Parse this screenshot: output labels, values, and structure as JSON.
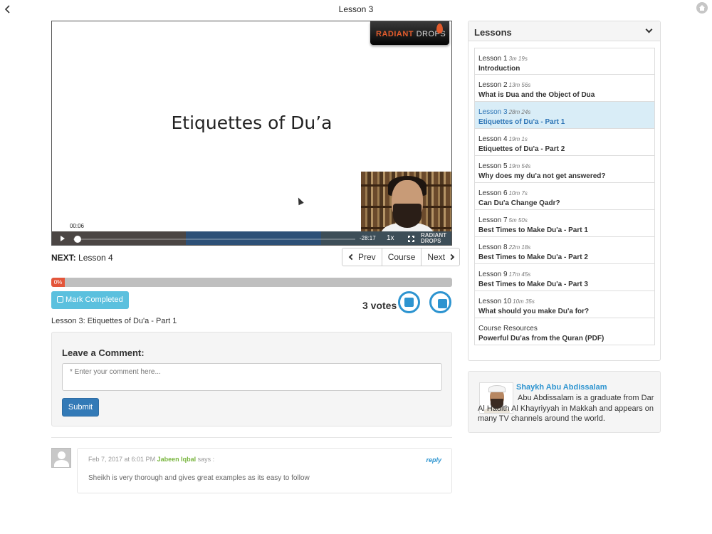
{
  "header": {
    "title": "Lesson 3"
  },
  "video": {
    "slide_title": "Etiquettes of Du’a",
    "brand_primary": "RADIANT",
    "brand_secondary": "DROPS",
    "current_time": "00:06",
    "remaining_time": "-28:17",
    "speed": "1x",
    "control_logo": "RADIANT DROPS"
  },
  "nav": {
    "next_label": "NEXT:",
    "next_value": "Lesson 4",
    "prev_button": "Prev",
    "course_button": "Course",
    "next_button": "Next"
  },
  "progress": {
    "percent_label": "0%",
    "value": 0
  },
  "actions": {
    "mark_completed": "Mark Completed",
    "votes": "3 votes"
  },
  "lesson_caption": "Lesson 3: Etiquettes of Du'a - Part 1",
  "comment_form": {
    "heading": "Leave a Comment:",
    "placeholder": "* Enter your comment here...",
    "submit": "Submit"
  },
  "comments": [
    {
      "date": "Feb 7, 2017 at 6:01 PM",
      "author": "Jabeen Iqbal",
      "says": "says :",
      "reply": "reply",
      "text": "Sheikh is very thorough and gives great examples as its easy to follow"
    }
  ],
  "sidebar": {
    "lessons_title": "Lessons",
    "lessons": [
      {
        "number": "Lesson 1",
        "duration": "3m 19s",
        "title": "Introduction",
        "active": false
      },
      {
        "number": "Lesson 2",
        "duration": "13m 56s",
        "title": "What is Dua and the Object of Dua",
        "active": false
      },
      {
        "number": "Lesson 3",
        "duration": "28m 24s",
        "title": "Etiquettes of Du'a - Part 1",
        "active": true
      },
      {
        "number": "Lesson 4",
        "duration": "19m 1s",
        "title": "Etiquettes of Du'a - Part 2",
        "active": false
      },
      {
        "number": "Lesson 5",
        "duration": "19m 54s",
        "title": "Why does my du'a not get answered?",
        "active": false
      },
      {
        "number": "Lesson 6",
        "duration": "10m 7s",
        "title": "Can Du'a Change Qadr?",
        "active": false
      },
      {
        "number": "Lesson 7",
        "duration": "5m 50s",
        "title": "Best Times to Make Du'a - Part 1",
        "active": false
      },
      {
        "number": "Lesson 8",
        "duration": "22m 18s",
        "title": "Best Times to Make Du'a - Part 2",
        "active": false
      },
      {
        "number": "Lesson 9",
        "duration": "17m 45s",
        "title": "Best Times to Make Du'a - Part 3",
        "active": false
      },
      {
        "number": "Lesson 10",
        "duration": "10m 35s",
        "title": "What should you make Du'a for?",
        "active": false
      },
      {
        "number": "Course Resources",
        "duration": "",
        "title": "Powerful Du'as from the Quran (PDF)",
        "active": false
      }
    ],
    "author": {
      "name": "Shaykh Abu Abdissalam",
      "bio": "Abu Abdissalam is a graduate from Dar Al Hadith Al Khayriyyah in Makkah and appears on many TV channels around the world."
    }
  },
  "icons": {
    "back": "chevron-left-icon",
    "home": "home-icon",
    "play": "play-icon",
    "fullscreen": "fullscreen-icon",
    "thumbs_up": "thumbs-up-icon",
    "vote_up": "vote-up-icon",
    "vote_down": "vote-down-icon",
    "collapse": "chevron-down-icon"
  },
  "colors": {
    "accent": "#337ab7",
    "info": "#5bc0de",
    "progress": "#e3553a",
    "active_lesson_bg": "#d9edf7",
    "author_name": "#2d94d0",
    "comment_author": "#78b53d"
  }
}
